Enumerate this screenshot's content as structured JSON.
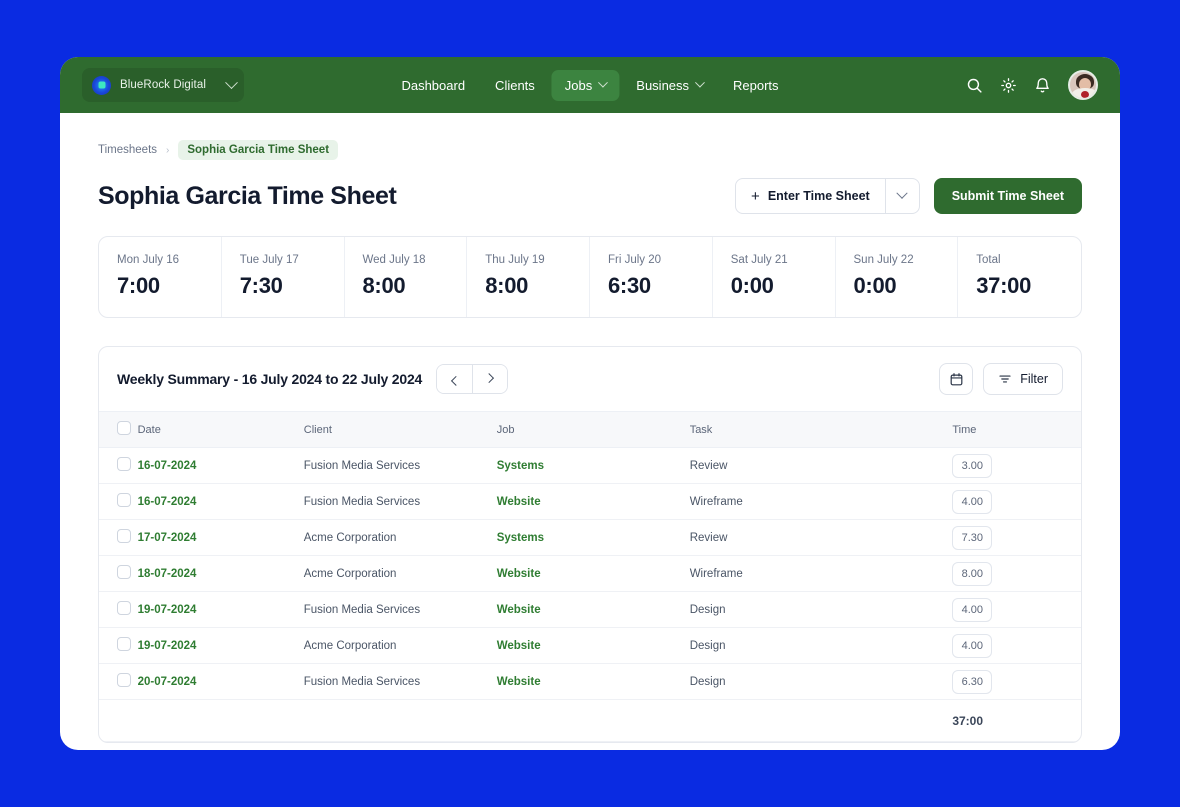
{
  "topnav": {
    "org_switcher": {
      "name": "BlueRock Digital",
      "logo_icon": "bluerock-logo",
      "caret_icon": "chevron-down-icon"
    },
    "items": [
      {
        "label": "Dashboard",
        "active": false,
        "has_caret": false
      },
      {
        "label": "Clients",
        "active": false,
        "has_caret": false
      },
      {
        "label": "Jobs",
        "active": true,
        "has_caret": true
      },
      {
        "label": "Business",
        "active": false,
        "has_caret": true
      },
      {
        "label": "Reports",
        "active": false,
        "has_caret": false
      }
    ],
    "actions": [
      {
        "icon": "search-icon"
      },
      {
        "icon": "gear-icon"
      },
      {
        "icon": "bell-icon"
      }
    ],
    "avatar_alt": "user-avatar",
    "bg_color": "#2F6B2F",
    "active_color": "#3C8440"
  },
  "breadcrumb": {
    "parent": "Timesheets",
    "separator": "›",
    "current": "Sophia Garcia Time Sheet"
  },
  "header": {
    "title": "Sophia Garcia Time Sheet",
    "enter_label": "Enter Time Sheet",
    "enter_plus": "+",
    "enter_caret_icon": "chevron-down-icon",
    "submit_label": "Submit Time Sheet"
  },
  "days": [
    {
      "label": "Mon July 16",
      "value": "7:00"
    },
    {
      "label": "Tue July 17",
      "value": "7:30"
    },
    {
      "label": "Wed July 18",
      "value": "8:00"
    },
    {
      "label": "Thu July 19",
      "value": "8:00"
    },
    {
      "label": "Fri July 20",
      "value": "6:30"
    },
    {
      "label": "Sat July 21",
      "value": "0:00"
    },
    {
      "label": "Sun July 22",
      "value": "0:00"
    },
    {
      "label": "Total",
      "value": "37:00"
    }
  ],
  "table": {
    "summary_title": "Weekly Summary - 16 July 2024 to 22 July 2024",
    "prev_icon": "chevron-left-icon",
    "next_icon": "chevron-right-icon",
    "calendar_icon": "calendar-icon",
    "filter_icon": "filter-icon",
    "filter_label": "Filter",
    "columns": [
      "Date",
      "Client",
      "Job",
      "Task",
      "Time"
    ],
    "rows": [
      {
        "date": "16-07-2024",
        "client": "Fusion Media Services",
        "job": "Systems",
        "task": "Review",
        "time": "3.00"
      },
      {
        "date": "16-07-2024",
        "client": "Fusion Media Services",
        "job": "Website",
        "task": "Wireframe",
        "time": "4.00"
      },
      {
        "date": "17-07-2024",
        "client": "Acme Corporation",
        "job": "Systems",
        "task": "Review",
        "time": "7.30"
      },
      {
        "date": "18-07-2024",
        "client": "Acme Corporation",
        "job": "Website",
        "task": "Wireframe",
        "time": "8.00"
      },
      {
        "date": "19-07-2024",
        "client": "Fusion Media Services",
        "job": "Website",
        "task": "Design",
        "time": "4.00"
      },
      {
        "date": "19-07-2024",
        "client": "Acme Corporation",
        "job": "Website",
        "task": "Design",
        "time": "4.00"
      },
      {
        "date": "20-07-2024",
        "client": "Fusion Media Services",
        "job": "Website",
        "task": "Design",
        "time": "6.30"
      }
    ],
    "total": "37:00"
  },
  "colors": {
    "page_bg": "#0A2BE2",
    "nav_green": "#2F6B2F",
    "accent_green": "#2F7D32",
    "text_dark": "#131B2E",
    "text_muted": "#6B7589"
  }
}
